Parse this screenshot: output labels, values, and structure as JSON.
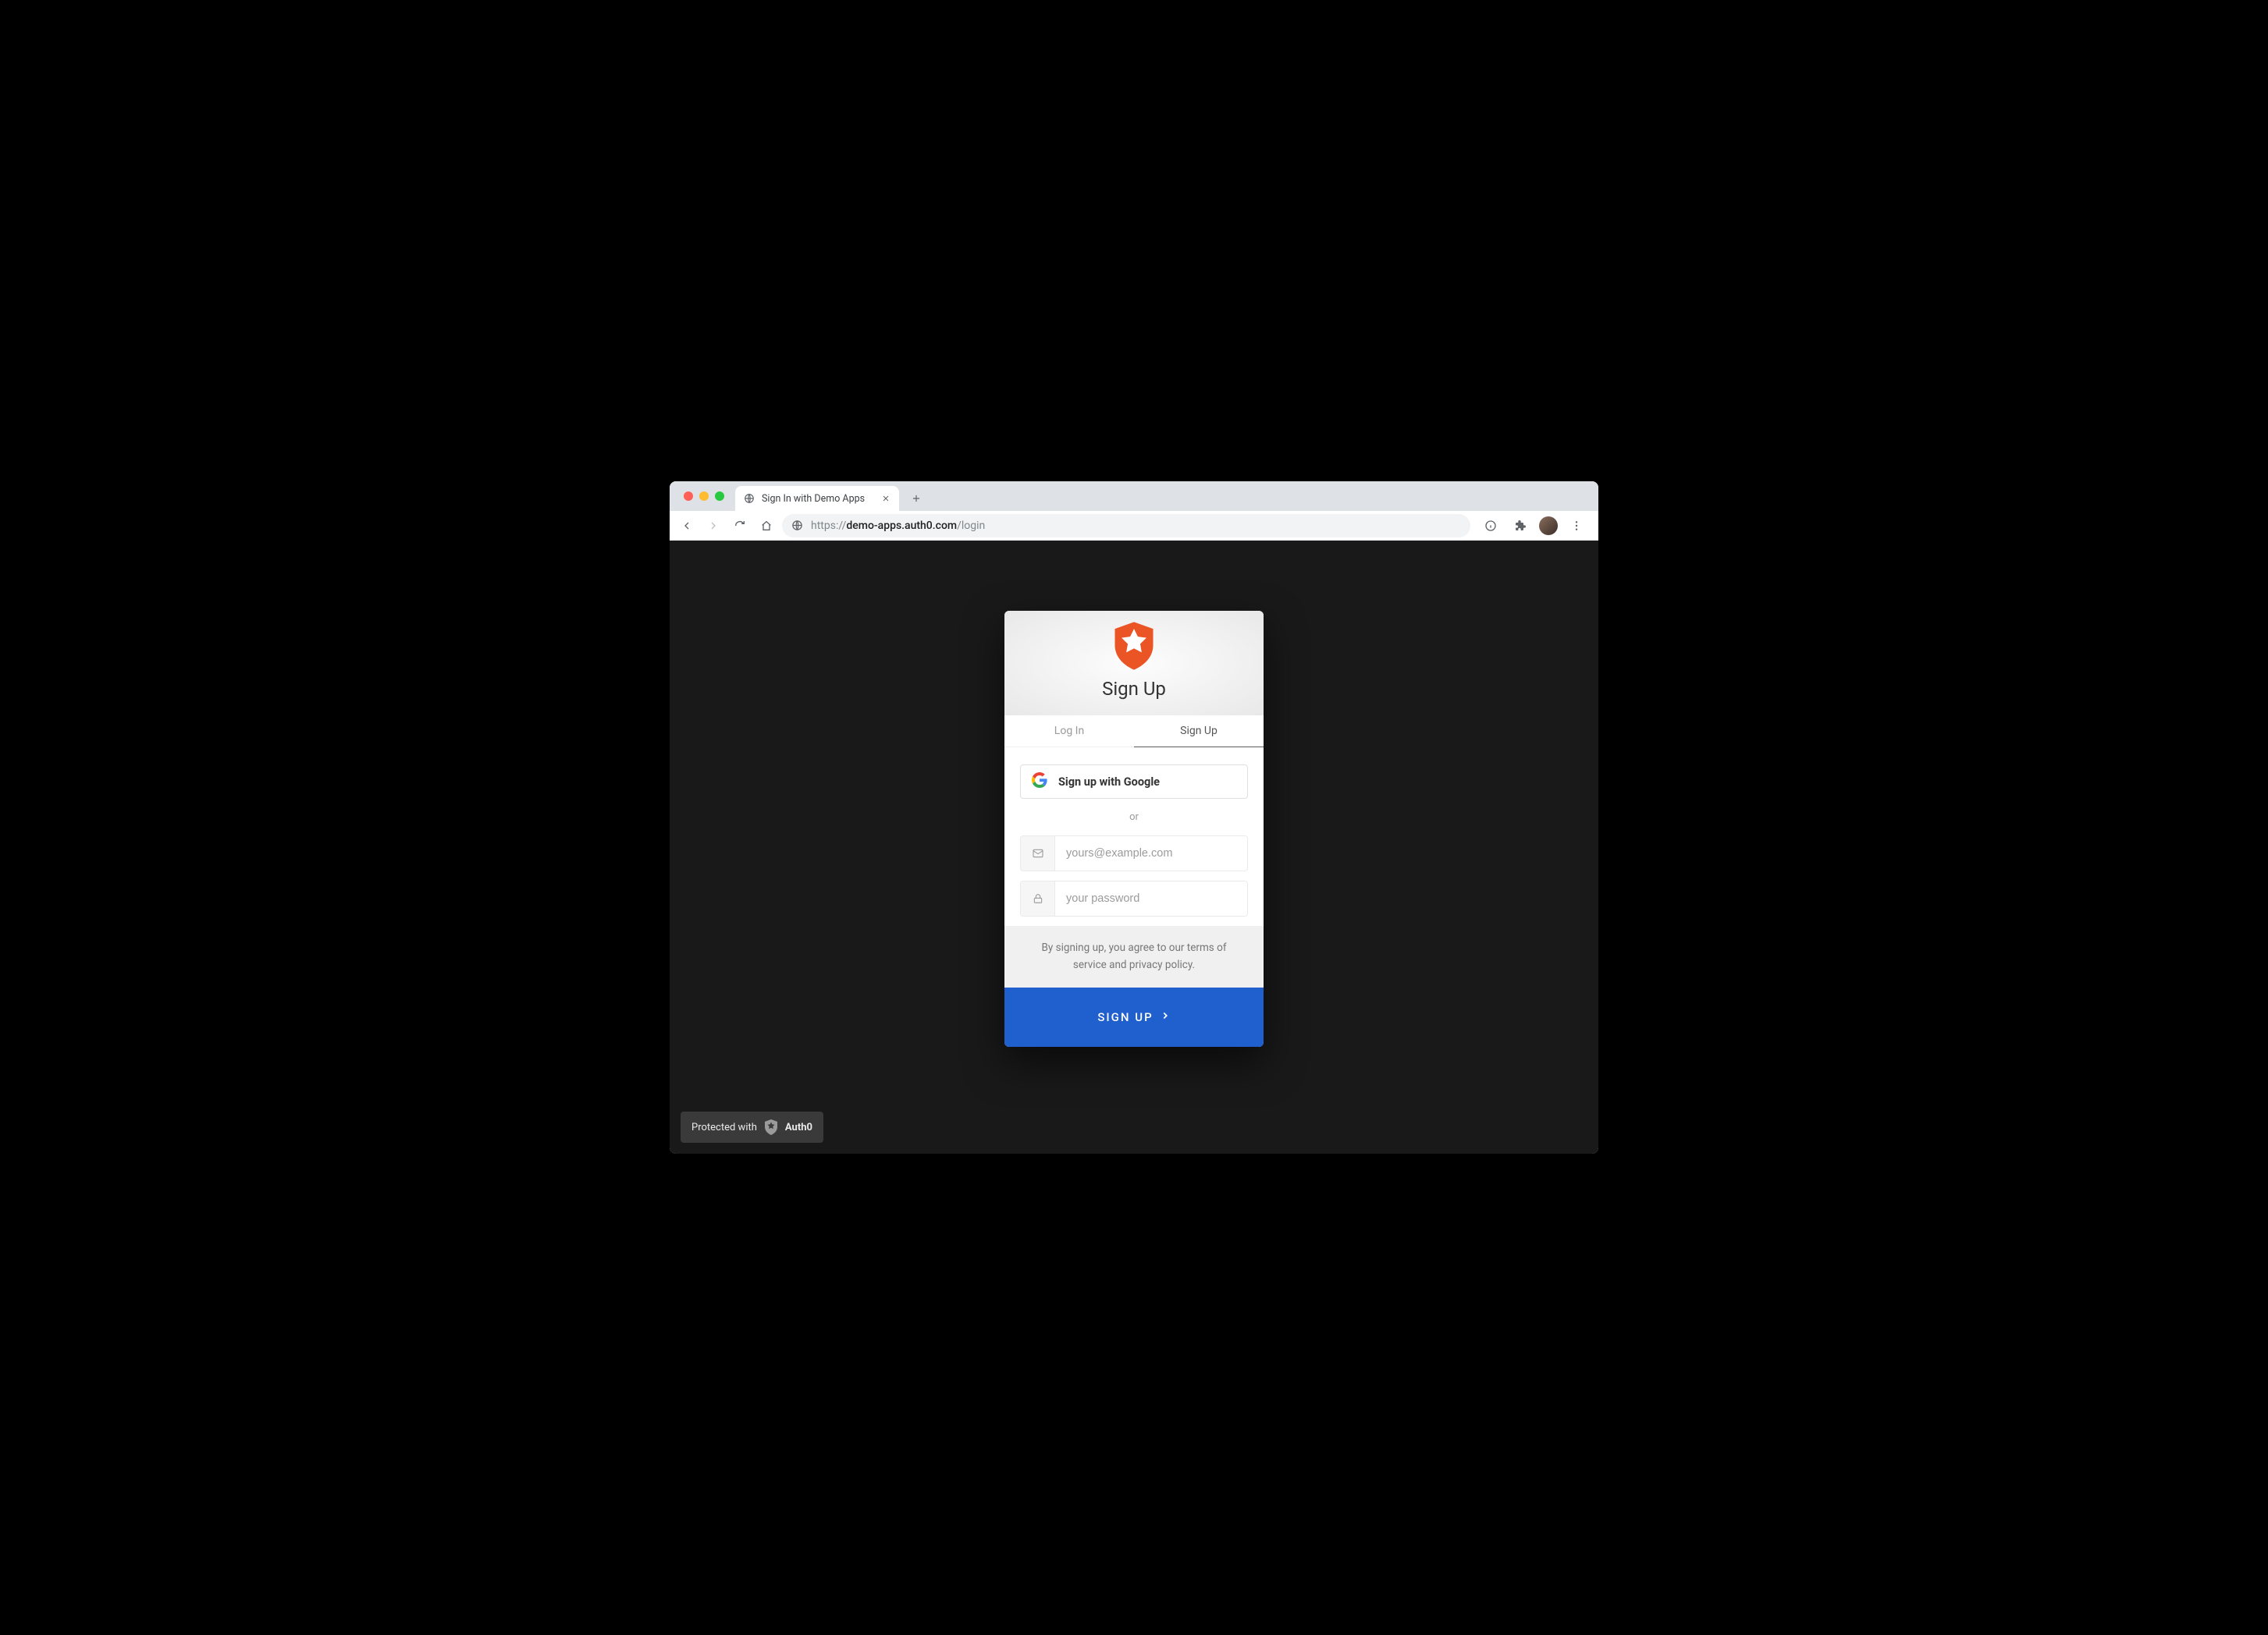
{
  "browser": {
    "tab_title": "Sign In with Demo Apps",
    "url_prefix": "https://",
    "url_host": "demo-apps.auth0.com",
    "url_path": "/login"
  },
  "lock": {
    "title": "Sign Up",
    "tabs": {
      "login": "Log In",
      "signup": "Sign Up"
    },
    "google_label": "Sign up with Google",
    "or": "or",
    "email_placeholder": "yours@example.com",
    "password_placeholder": "your password",
    "terms": "By signing up, you agree to our terms of service and privacy policy.",
    "submit": "SIGN UP"
  },
  "badge": {
    "prefix": "Protected with",
    "brand": "Auth0"
  },
  "colors": {
    "accent": "#eb5424",
    "submit": "#205fce",
    "page_bg": "#191919"
  }
}
